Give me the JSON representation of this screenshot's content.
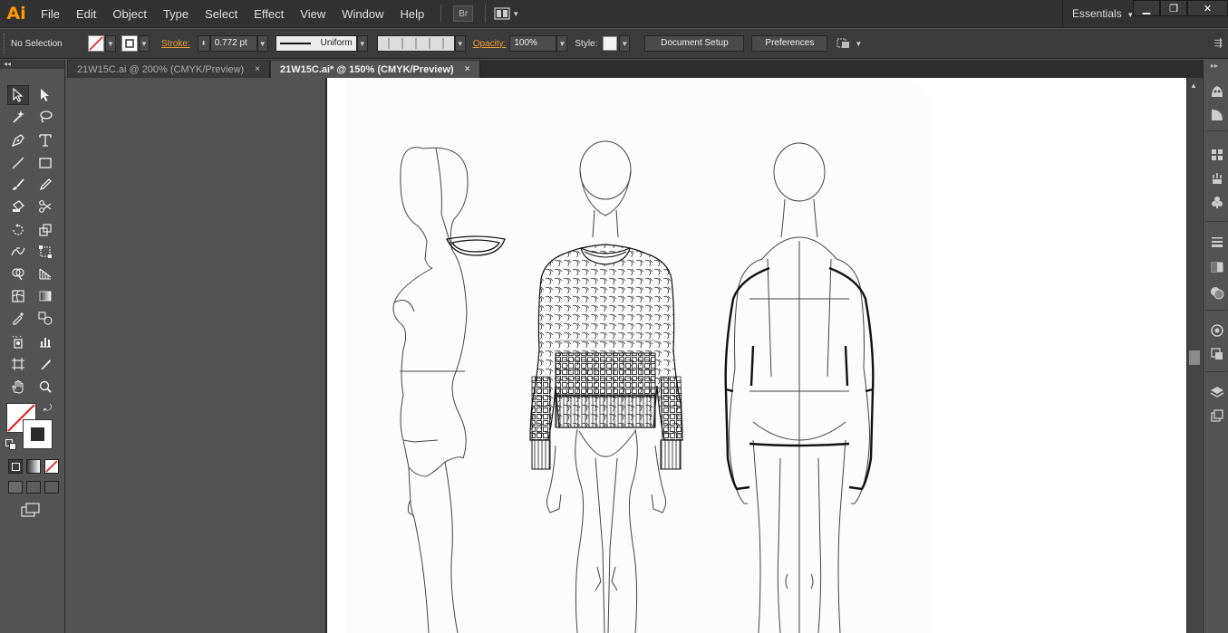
{
  "app": {
    "logo": "Ai",
    "bridge_label": "Br"
  },
  "menu": [
    "File",
    "Edit",
    "Object",
    "Type",
    "Select",
    "Effect",
    "View",
    "Window",
    "Help"
  ],
  "workspace": {
    "label": "Essentials",
    "arrow": "▾"
  },
  "window_controls": {
    "minimize": "▁",
    "restore": "❐",
    "close": "✕"
  },
  "controlbar": {
    "selection": "No Selection",
    "stroke_label": "Stroke:",
    "stroke_weight": "0.772 pt",
    "profile": "Uniform",
    "opacity_label": "Opacity:",
    "opacity_value": "100%",
    "style_label": "Style:",
    "document_setup": "Document Setup",
    "preferences": "Preferences"
  },
  "tabs": [
    {
      "label": "21W15C.ai @ 200% (CMYK/Preview)",
      "active": false,
      "close": "×"
    },
    {
      "label": "21W15C.ai* @ 150% (CMYK/Preview)",
      "active": true,
      "close": "×"
    }
  ],
  "toolbox": {
    "collapse": "◂◂",
    "tools": [
      "selection-tool",
      "direct-selection-tool",
      "magic-wand-tool",
      "lasso-tool",
      "pen-tool",
      "type-tool",
      "line-segment-tool",
      "rectangle-tool",
      "paintbrush-tool",
      "pencil-tool",
      "blob-brush-tool",
      "scissors-tool",
      "rotate-tool",
      "scale-tool",
      "width-tool",
      "free-transform-tool",
      "shape-builder-tool",
      "perspective-grid-tool",
      "mesh-tool",
      "gradient-tool",
      "eyedropper-tool",
      "blend-tool",
      "symbol-sprayer-tool",
      "column-graph-tool",
      "artboard-tool",
      "slice-tool",
      "hand-tool",
      "zoom-tool"
    ]
  },
  "colors": {
    "accent": "#ff9a00",
    "stroke_none": "#e02020",
    "artboard": "#ffffff",
    "canvas": "#535353"
  }
}
